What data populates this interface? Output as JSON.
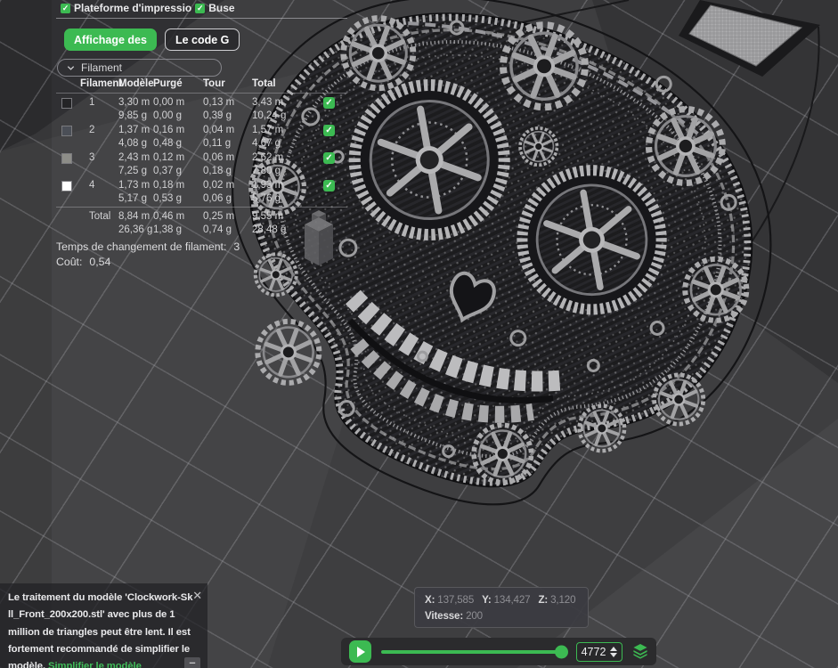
{
  "accent": {
    "green": "#3cba52",
    "link_green": "#41bd5a"
  },
  "view_options": [
    {
      "label": "Plateforme d'impressio",
      "checked": true
    },
    {
      "label": "Buse",
      "checked": true
    }
  ],
  "tabs": [
    {
      "label": "Affichage des",
      "active": true
    },
    {
      "label": "Le code G",
      "active": false
    }
  ],
  "filter_dropdown": {
    "label": "Filament"
  },
  "filament_table": {
    "headers": [
      "Filament",
      "Modèle",
      "Purgé",
      "Tour",
      "Total"
    ],
    "rows": [
      {
        "id": "1",
        "swatch": "#242426",
        "checked": true,
        "cells": [
          [
            "3,30 m",
            "9,85 g"
          ],
          [
            "0,00 m",
            "0,00 g"
          ],
          [
            "0,13 m",
            "0,39 g"
          ],
          [
            "3,43 m",
            "10,24 g"
          ]
        ]
      },
      {
        "id": "2",
        "swatch": "#4b4f57",
        "checked": true,
        "cells": [
          [
            "1,37 m",
            "4,08 g"
          ],
          [
            "0,16 m",
            "0,48 g"
          ],
          [
            "0,04 m",
            "0,11 g"
          ],
          [
            "1,57 m",
            "4,67 g"
          ]
        ]
      },
      {
        "id": "3",
        "swatch": "#8d8d88",
        "checked": true,
        "cells": [
          [
            "2,43 m",
            "7,25 g"
          ],
          [
            "0,12 m",
            "0,37 g"
          ],
          [
            "0,06 m",
            "0,18 g"
          ],
          [
            "2,62 m",
            "7,80 g"
          ]
        ]
      },
      {
        "id": "4",
        "swatch": "#ffffff",
        "checked": true,
        "cells": [
          [
            "1,73 m",
            "5,17 g"
          ],
          [
            "0,18 m",
            "0,53 g"
          ],
          [
            "0,02 m",
            "0,06 g"
          ],
          [
            "1,93 m",
            "5,76 g"
          ]
        ]
      }
    ],
    "total": {
      "label": "Total",
      "cells": [
        [
          "8,84 m",
          "26,36 g"
        ],
        [
          "0,46 m",
          "1,38 g"
        ],
        [
          "0,25 m",
          "0,74 g"
        ],
        [
          "9,55 m",
          "28,48 g"
        ]
      ]
    }
  },
  "stats": {
    "changes_label": "Temps de changement de filament:",
    "changes_value": "3",
    "cost_label": "Coût:",
    "cost_value": "0,54"
  },
  "warning_toast": {
    "lines": [
      "Le traitement du modèle 'Clockwork-Sk",
      "ll_Front_200x200.stl' avec plus de 1",
      "million de triangles peut être lent. Il est",
      "fortement recommandé de simplifier le"
    ],
    "last_line_prefix": "modèle. ",
    "link_label": "Simplifier le modèle",
    "close_icon": "✕",
    "minimize_icon": "–"
  },
  "status_tooltip": {
    "coords": [
      {
        "label": "X:",
        "value": "137,585"
      },
      {
        "label": "Y:",
        "value": "134,427"
      },
      {
        "label": "Z:",
        "value": "3,120"
      }
    ],
    "speed": {
      "label": "Vitesse:",
      "value": "200"
    }
  },
  "playbar": {
    "layer_value": "4772"
  }
}
